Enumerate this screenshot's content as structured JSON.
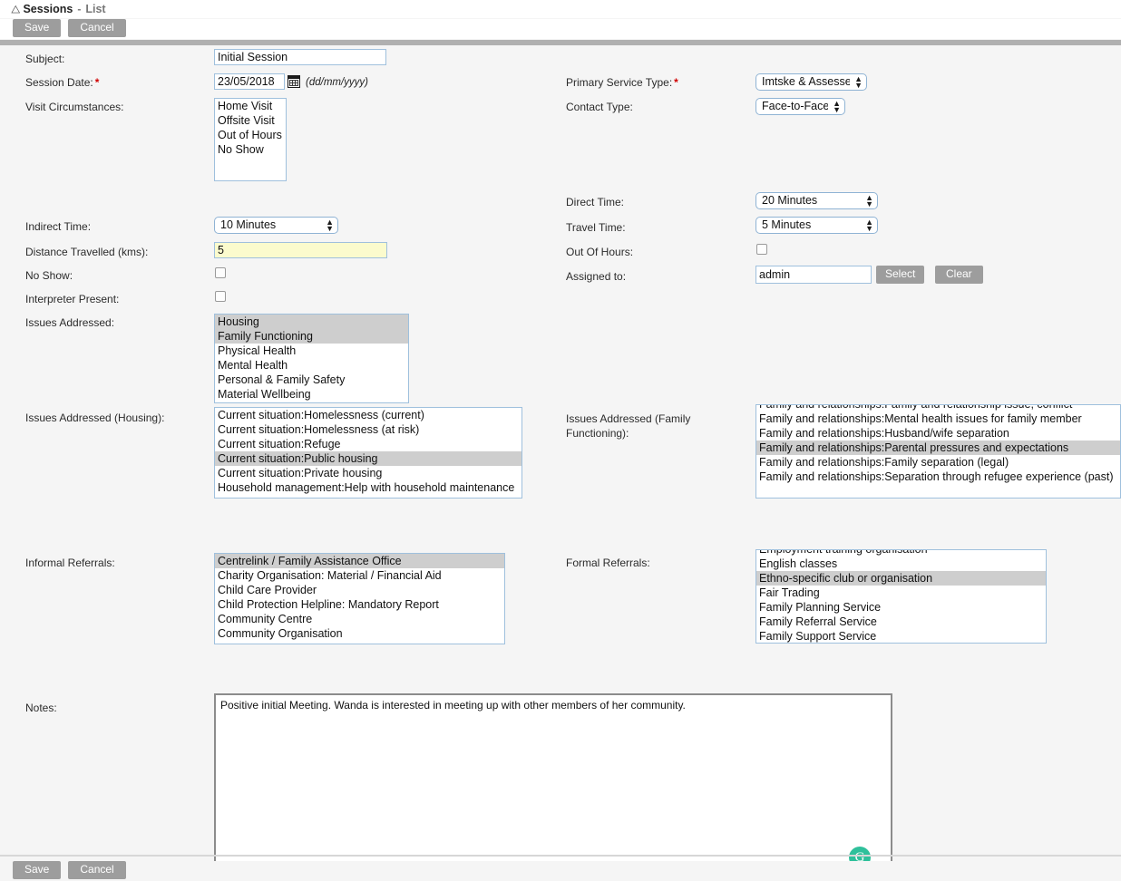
{
  "breadcrumb": {
    "collapse_icon": "chevron-collapse-icon",
    "title": "Sessions",
    "separator": "-",
    "subtitle": "List"
  },
  "toolbar": {
    "save_label": "Save",
    "cancel_label": "Cancel"
  },
  "form": {
    "subject": {
      "label": "Subject:",
      "value": "Initial Session"
    },
    "session_date": {
      "label": "Session Date:",
      "required": "*",
      "value": "23/05/2018",
      "format_hint": "(dd/mm/yyyy)",
      "calendar_icon": "calendar-icon"
    },
    "visit_circumstances": {
      "label": "Visit Circumstances:",
      "options": [
        "Home Visit",
        "Offsite Visit",
        "Out of Hours",
        "No Show"
      ],
      "selected": []
    },
    "primary_service_type": {
      "label": "Primary Service Type:",
      "required": "*",
      "value": "Imtske & Assesse"
    },
    "contact_type": {
      "label": "Contact Type:",
      "value": "Face-to-Face"
    },
    "direct_time": {
      "label": "Direct Time:",
      "value": "20 Minutes"
    },
    "travel_time": {
      "label": "Travel Time:",
      "value": "5 Minutes"
    },
    "indirect_time": {
      "label": "Indirect Time:",
      "value": "10 Minutes"
    },
    "distance_travelled": {
      "label": "Distance Travelled (kms):",
      "value": "5"
    },
    "out_of_hours": {
      "label": "Out Of Hours:",
      "checked": false
    },
    "no_show": {
      "label": "No Show:",
      "checked": false
    },
    "interpreter_present": {
      "label": "Interpreter Present:",
      "checked": false
    },
    "assigned_to": {
      "label": "Assigned to:",
      "value": "admin",
      "select_label": "Select",
      "clear_label": "Clear"
    },
    "issues_addressed": {
      "label": "Issues Addressed:",
      "options": [
        {
          "text": "Housing",
          "selected": true
        },
        {
          "text": "Family Functioning",
          "selected": true
        },
        {
          "text": "Physical Health",
          "selected": false
        },
        {
          "text": "Mental Health",
          "selected": false
        },
        {
          "text": "Personal & Family Safety",
          "selected": false
        },
        {
          "text": "Material Wellbeing",
          "selected": false
        }
      ]
    },
    "issues_housing": {
      "label": "Issues Addressed (Housing):",
      "options": [
        {
          "text": "Current situation:Homelessness (current)",
          "selected": false
        },
        {
          "text": "Current situation:Homelessness (at risk)",
          "selected": false
        },
        {
          "text": "Current situation:Refuge",
          "selected": false
        },
        {
          "text": "Current situation:Public housing",
          "selected": true
        },
        {
          "text": "Current situation:Private housing",
          "selected": false
        },
        {
          "text": "Household management:Help with household maintenance",
          "selected": false
        }
      ]
    },
    "issues_family_functioning": {
      "label": "Issues Addressed (Family Functioning):",
      "scrolled": true,
      "options": [
        {
          "text": "Family and relationships:Family and relationship issue, conflict",
          "selected": false
        },
        {
          "text": "Family and relationships:Mental health issues for family member",
          "selected": false
        },
        {
          "text": "Family and relationships:Husband/wife separation",
          "selected": false
        },
        {
          "text": "Family and relationships:Parental pressures and expectations",
          "selected": true
        },
        {
          "text": "Family and relationships:Family separation (legal)",
          "selected": false
        },
        {
          "text": "Family and relationships:Separation through refugee experience (past)",
          "selected": false
        }
      ]
    },
    "informal_referrals": {
      "label": "Informal Referrals:",
      "options": [
        {
          "text": "Centrelink / Family Assistance Office",
          "selected": true
        },
        {
          "text": "Charity Organisation: Material / Financial Aid",
          "selected": false
        },
        {
          "text": "Child Care Provider",
          "selected": false
        },
        {
          "text": "Child Protection Helpline: Mandatory Report",
          "selected": false
        },
        {
          "text": "Community Centre",
          "selected": false
        },
        {
          "text": "Community Organisation",
          "selected": false
        }
      ]
    },
    "formal_referrals": {
      "label": "Formal Referrals:",
      "scrolled": true,
      "options": [
        {
          "text": "Employment training organisation",
          "selected": false
        },
        {
          "text": "English classes",
          "selected": false
        },
        {
          "text": "Ethno-specific club or organisation",
          "selected": true
        },
        {
          "text": "Fair Trading",
          "selected": false
        },
        {
          "text": "Family Planning Service",
          "selected": false
        },
        {
          "text": "Family Referral Service",
          "selected": false
        },
        {
          "text": "Family Support Service",
          "selected": false
        }
      ]
    },
    "notes": {
      "label": "Notes:",
      "value": "Positive initial Meeting. Wanda is interested in meeting up with other members of her community.",
      "grammarly_icon": "G"
    }
  },
  "colors": {
    "button_gray": "#9d9d9d",
    "selected_row": "#cecece",
    "highlight_field": "#fbfbcd",
    "required_red": "#d00000",
    "grammarly_green": "#2fc09b",
    "field_border_blue": "#9fc0dd"
  }
}
